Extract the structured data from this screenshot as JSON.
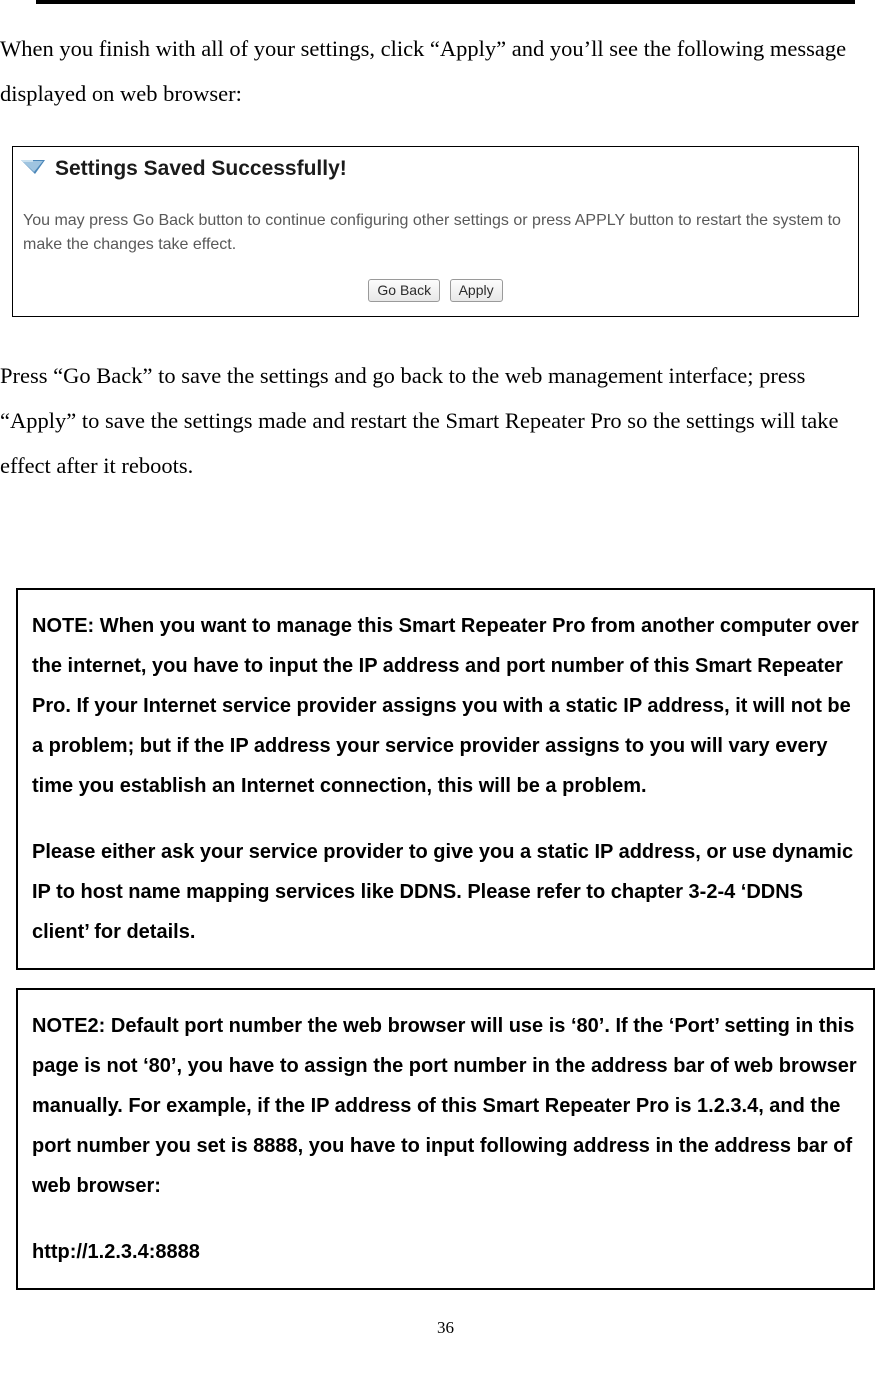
{
  "intro_para": "When you finish with all of your settings, click “Apply” and you’ll see the following message displayed on web browser:",
  "screenshot": {
    "title": "Settings Saved Successfully!",
    "subtext": "You may press Go Back button to continue configuring other settings or press APPLY button to restart the system to make the changes take effect.",
    "go_back_label": "Go Back",
    "apply_label": "Apply"
  },
  "outro_para": "Press “Go Back” to save the settings and go back to the web management interface; press “Apply” to save the settings made and restart the Smart Repeater Pro so the settings will take effect after it reboots.",
  "note1_part1": "NOTE: When you want to manage this Smart Repeater Pro from another computer over the internet, you have to input the IP address and port number of this Smart Repeater Pro. If your Internet service provider assigns you with a static IP address, it will not be a problem; but if the IP address your service provider assigns to you will vary every time you establish an Internet connection, this will be a problem.",
  "note1_part2": "Please either ask your service provider to give you a static IP address, or use dynamic IP to host name mapping services like DDNS. Please refer to chapter 3-2-4 ‘DDNS client’ for details.",
  "note2_part1": "NOTE2: Default port number the web browser will use is ‘80’. If the ‘Port’ setting in this page is not ‘80’, you have to assign the port number in the address bar of web browser manually. For example, if the IP address of this Smart Repeater Pro is 1.2.3.4, and the port number you set is 8888, you have to input following address in the address bar of web browser:",
  "note2_url": "http://1.2.3.4:8888",
  "page_number": "36"
}
